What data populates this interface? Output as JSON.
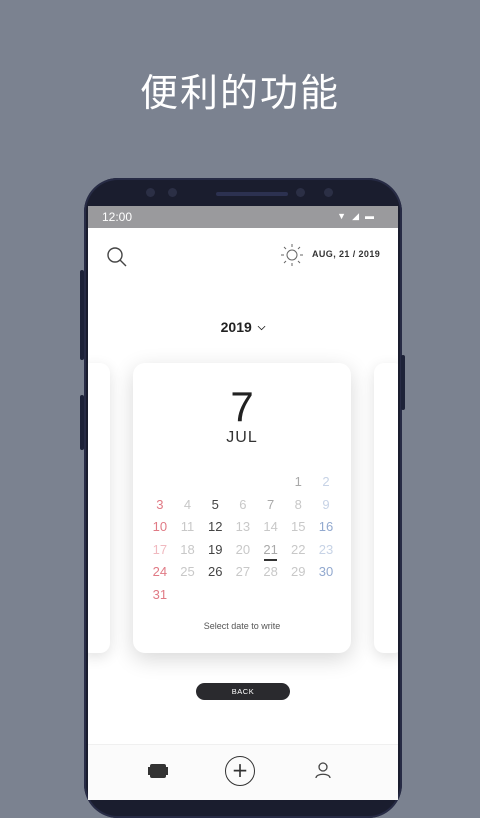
{
  "headline": "便利的功能",
  "status": {
    "time": "12:00"
  },
  "header": {
    "date": "AUG, 21 / 2019"
  },
  "year_select": {
    "year": "2019"
  },
  "card": {
    "day": "7",
    "month": "JUL",
    "weeks": [
      [
        {
          "t": "",
          "c": ""
        },
        {
          "t": "",
          "c": ""
        },
        {
          "t": "",
          "c": ""
        },
        {
          "t": "",
          "c": ""
        },
        {
          "t": "",
          "c": ""
        },
        {
          "t": "1",
          "c": "mid"
        },
        {
          "t": "2",
          "c": "bluel"
        }
      ],
      [
        {
          "t": "3",
          "c": "red"
        },
        {
          "t": "4",
          "c": ""
        },
        {
          "t": "5",
          "c": "dark"
        },
        {
          "t": "6",
          "c": ""
        },
        {
          "t": "7",
          "c": "mid"
        },
        {
          "t": "8",
          "c": ""
        },
        {
          "t": "9",
          "c": "bluel"
        }
      ],
      [
        {
          "t": "10",
          "c": "red"
        },
        {
          "t": "11",
          "c": ""
        },
        {
          "t": "12",
          "c": "dark"
        },
        {
          "t": "13",
          "c": ""
        },
        {
          "t": "14",
          "c": ""
        },
        {
          "t": "15",
          "c": ""
        },
        {
          "t": "16",
          "c": "blue"
        }
      ],
      [
        {
          "t": "17",
          "c": "redl"
        },
        {
          "t": "18",
          "c": ""
        },
        {
          "t": "19",
          "c": "dark"
        },
        {
          "t": "20",
          "c": ""
        },
        {
          "t": "21",
          "c": "mid today"
        },
        {
          "t": "22",
          "c": ""
        },
        {
          "t": "23",
          "c": "bluel"
        }
      ],
      [
        {
          "t": "24",
          "c": "red"
        },
        {
          "t": "25",
          "c": ""
        },
        {
          "t": "26",
          "c": "dark"
        },
        {
          "t": "27",
          "c": ""
        },
        {
          "t": "28",
          "c": ""
        },
        {
          "t": "29",
          "c": ""
        },
        {
          "t": "30",
          "c": "blue"
        }
      ],
      [
        {
          "t": "31",
          "c": "red"
        },
        {
          "t": "",
          "c": ""
        },
        {
          "t": "",
          "c": ""
        },
        {
          "t": "",
          "c": ""
        },
        {
          "t": "",
          "c": ""
        },
        {
          "t": "",
          "c": ""
        },
        {
          "t": "",
          "c": ""
        }
      ]
    ],
    "hint": "Select date to write"
  },
  "back_label": "BACK",
  "colors": {
    "background": "#7b8290",
    "weekend_red": "#e07a85",
    "weekend_blue": "#92a9cf"
  },
  "icons": {
    "search": "search-icon",
    "sun": "sun-icon",
    "calendar": "calendar-icon",
    "add": "plus-icon",
    "user": "user-icon"
  }
}
